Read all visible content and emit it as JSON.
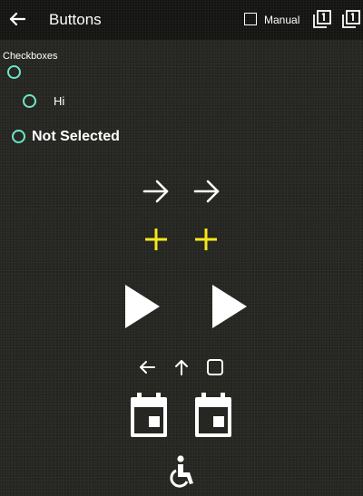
{
  "appbar": {
    "title": "Buttons",
    "back_icon": "arrow-left-icon",
    "manual_label": "Manual",
    "manual_checked": false,
    "page_one_icon": "filter-1-icon"
  },
  "section": {
    "label": "Checkboxes"
  },
  "radios": [
    {
      "label": "",
      "selected": false
    },
    {
      "label": "Hi",
      "selected": false
    },
    {
      "label": "Not Selected",
      "selected": false
    }
  ],
  "icon_rows": [
    {
      "icon": "arrow-right-icon",
      "color": "#ffffff",
      "count": 2
    },
    {
      "icon": "plus-icon",
      "color": "#f5e61e",
      "count": 2
    },
    {
      "icon": "play-icon",
      "color": "#ffffff",
      "count": 2
    },
    {
      "icons": [
        "arrow-left-icon",
        "arrow-up-icon",
        "stop-square-icon"
      ],
      "color": "#ffffff"
    },
    {
      "icon": "calendar-icon",
      "color": "#ffffff",
      "count": 2
    },
    {
      "icon": "accessible-icon",
      "color": "#ffffff",
      "count": 1
    }
  ],
  "colors": {
    "background": "#262622",
    "appbar": "#141413",
    "radio_accent": "#6ee6c4",
    "plus_accent": "#f5e61e"
  }
}
